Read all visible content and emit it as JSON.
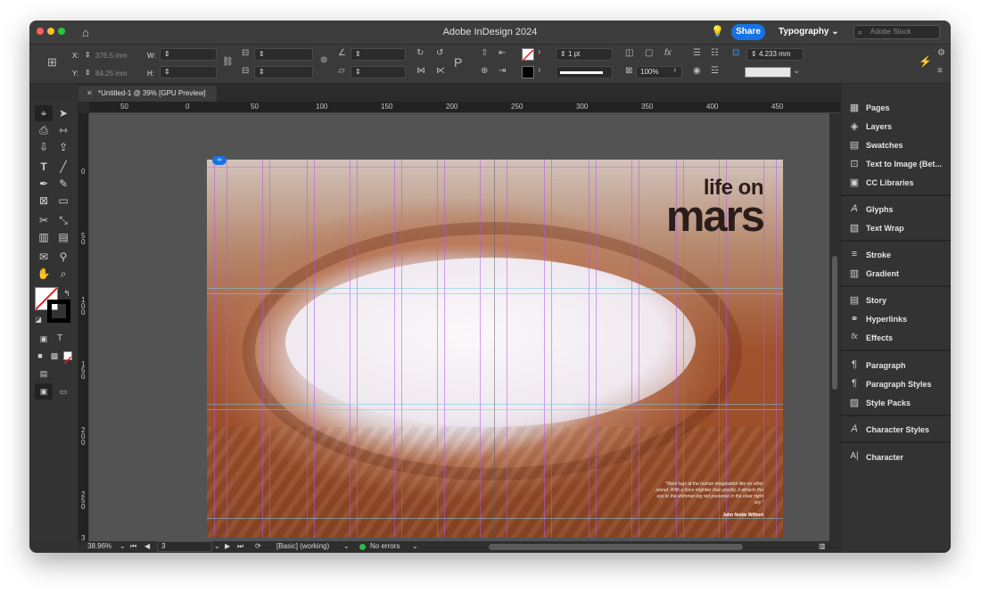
{
  "app": {
    "title": "Adobe InDesign 2024",
    "share_label": "Share",
    "workspace": "Typography",
    "stock_placeholder": "Adobe Stock"
  },
  "control": {
    "x_label": "X:",
    "x_value": "376.5 mm",
    "y_label": "Y:",
    "y_value": "84.25 mm",
    "w_label": "W:",
    "h_label": "H:",
    "stroke_weight": "1 pt",
    "opacity": "100%",
    "size_value": "4.233 mm"
  },
  "tab": {
    "title": "*Untitled-1 @ 39% [GPU Preview]"
  },
  "ruler": {
    "h_labels": [
      "50",
      "0",
      "50",
      "100",
      "150",
      "200",
      "250",
      "300",
      "350",
      "400",
      "450"
    ],
    "v_labels": [
      "0",
      "5\n0",
      "1\n0\n0",
      "1\n5\n0",
      "2\n0\n0",
      "2\n5\n0",
      "3"
    ]
  },
  "document": {
    "headline_1": "life on",
    "headline_2": "mars",
    "quote": "\"Mars tugs at the human imagination like no other planet. With a force mightier than gravity, it attracts the eye to the shimmer-ing red presence in the clear night sky.\"",
    "author": "John Noble Wilford"
  },
  "status": {
    "zoom": "38.96%",
    "page": "3",
    "style": "[Basic] (working)",
    "preflight": "No errors",
    "preflight_color": "#2fb84c"
  },
  "panels": [
    {
      "label": "Pages",
      "icon": "pages-icon",
      "glyph": "▦"
    },
    {
      "label": "Layers",
      "icon": "layers-icon",
      "glyph": "◈"
    },
    {
      "label": "Swatches",
      "icon": "swatches-icon",
      "glyph": "▤"
    },
    {
      "label": "Text to Image (Bet...",
      "icon": "text-to-image-icon",
      "glyph": "⊡"
    },
    {
      "label": "CC Libraries",
      "icon": "cc-libraries-icon",
      "glyph": "▣"
    },
    {
      "label": "Glyphs",
      "icon": "glyphs-icon",
      "glyph": "A"
    },
    {
      "label": "Text Wrap",
      "icon": "text-wrap-icon",
      "glyph": "▧"
    },
    {
      "label": "Stroke",
      "icon": "stroke-icon",
      "glyph": "≡"
    },
    {
      "label": "Gradient",
      "icon": "gradient-icon",
      "glyph": "▥"
    },
    {
      "label": "Story",
      "icon": "story-icon",
      "glyph": "▤"
    },
    {
      "label": "Hyperlinks",
      "icon": "hyperlinks-icon",
      "glyph": "⚭"
    },
    {
      "label": "Effects",
      "icon": "effects-icon",
      "glyph": "fx"
    },
    {
      "label": "Paragraph",
      "icon": "paragraph-icon",
      "glyph": "¶"
    },
    {
      "label": "Paragraph Styles",
      "icon": "paragraph-styles-icon",
      "glyph": "¶"
    },
    {
      "label": "Style Packs",
      "icon": "style-packs-icon",
      "glyph": "▨"
    },
    {
      "label": "Character Styles",
      "icon": "character-styles-icon",
      "glyph": "A"
    },
    {
      "label": "Character",
      "icon": "character-icon",
      "glyph": "A|"
    }
  ],
  "colors": {
    "accent": "#1473e6",
    "chrome": "#323232",
    "panel": "#333333"
  }
}
